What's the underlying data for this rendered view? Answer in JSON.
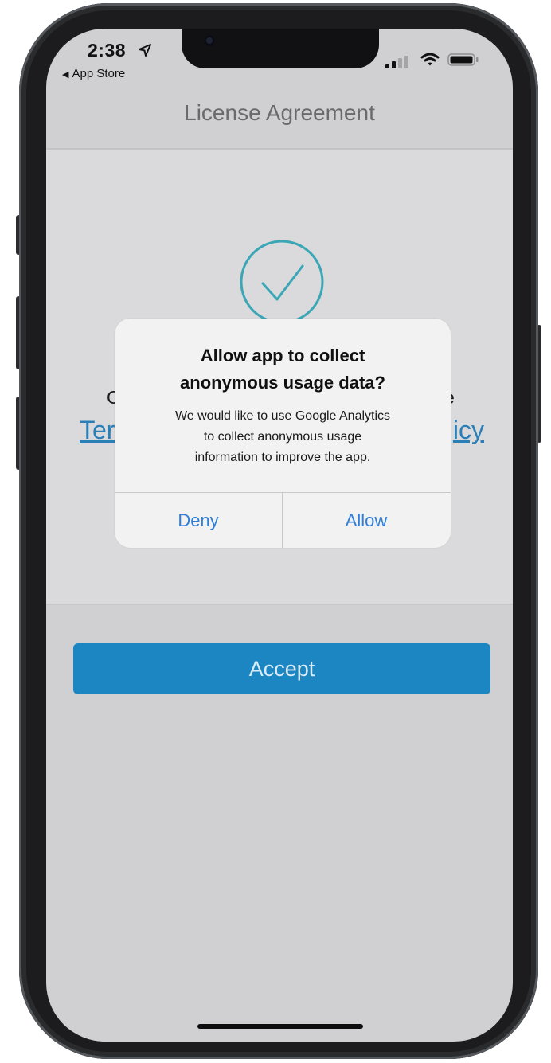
{
  "status_bar": {
    "time": "2:38",
    "back_label": "App Store",
    "icons": [
      "location-arrow-icon",
      "cellular-signal-icon",
      "wifi-icon",
      "battery-icon"
    ]
  },
  "navigation": {
    "title": "License Agreement"
  },
  "content": {
    "agree_text_left": "C",
    "agree_text_right": "e",
    "terms_link_fragment": "Ter",
    "privacy_link_fragment": "icy",
    "check_icon": "checkmark-circle-icon"
  },
  "accept_button": {
    "label": "Accept"
  },
  "alert": {
    "title_line1": "Allow app to collect",
    "title_line2": "anonymous usage data?",
    "message_line1": "We would like to use Google Analytics",
    "message_line2": "to collect anonymous usage",
    "message_line3": "information to improve the app.",
    "deny_label": "Deny",
    "allow_label": "Allow"
  },
  "colors": {
    "accent": "#1b86c2",
    "link": "#2a7fb6",
    "alert_button": "#2f7ed8",
    "check": "#3aa6b6"
  }
}
